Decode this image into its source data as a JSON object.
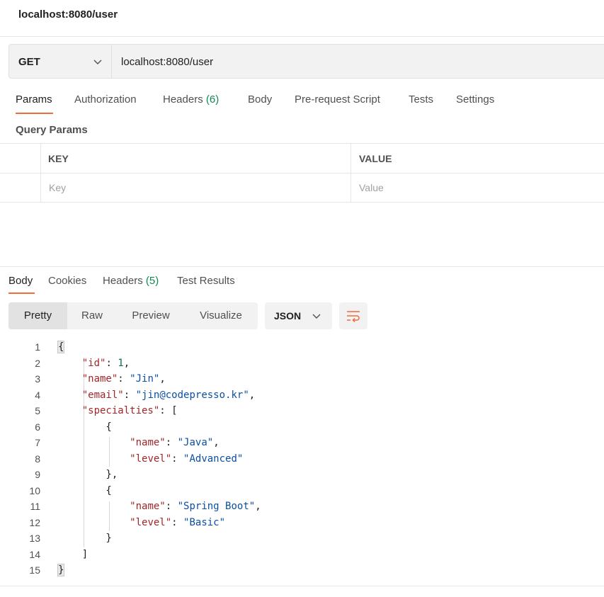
{
  "header": {
    "title": "localhost:8080/user"
  },
  "request": {
    "method": "GET",
    "url": "localhost:8080/user",
    "tabs": [
      {
        "label": "Params",
        "count": ""
      },
      {
        "label": "Authorization",
        "count": ""
      },
      {
        "label": "Headers",
        "count": "(6)"
      },
      {
        "label": "Body",
        "count": ""
      },
      {
        "label": "Pre-request Script",
        "count": ""
      },
      {
        "label": "Tests",
        "count": ""
      },
      {
        "label": "Settings",
        "count": ""
      }
    ],
    "active_tab": "Params",
    "query_params": {
      "title": "Query Params",
      "columns": [
        "KEY",
        "VALUE"
      ],
      "placeholder_key": "Key",
      "placeholder_value": "Value"
    }
  },
  "response": {
    "tabs": [
      {
        "label": "Body",
        "count": ""
      },
      {
        "label": "Cookies",
        "count": ""
      },
      {
        "label": "Headers",
        "count": "(5)"
      },
      {
        "label": "Test Results",
        "count": ""
      }
    ],
    "active_tab": "Body",
    "view_modes": [
      "Pretty",
      "Raw",
      "Preview",
      "Visualize"
    ],
    "active_view": "Pretty",
    "format": "JSON",
    "code_lines": [
      "1",
      "2",
      "3",
      "4",
      "5",
      "6",
      "7",
      "8",
      "9",
      "10",
      "11",
      "12",
      "13",
      "14",
      "15"
    ],
    "body": {
      "id": 1,
      "name": "Jin",
      "email": "jin@codepresso.kr",
      "specialties": [
        {
          "name": "Java",
          "level": "Advanced"
        },
        {
          "name": "Spring Boot",
          "level": "Basic"
        }
      ]
    }
  },
  "colors": {
    "accent": "#f26b3a",
    "count_green": "#0f8a4f",
    "json_key": "#a1262a",
    "json_string": "#0b4fa3",
    "json_number": "#0b6e4f"
  },
  "icons": {
    "method_dropdown": "chevron-down-icon",
    "format_dropdown": "chevron-down-icon",
    "wrap": "wrap-lines-icon"
  }
}
